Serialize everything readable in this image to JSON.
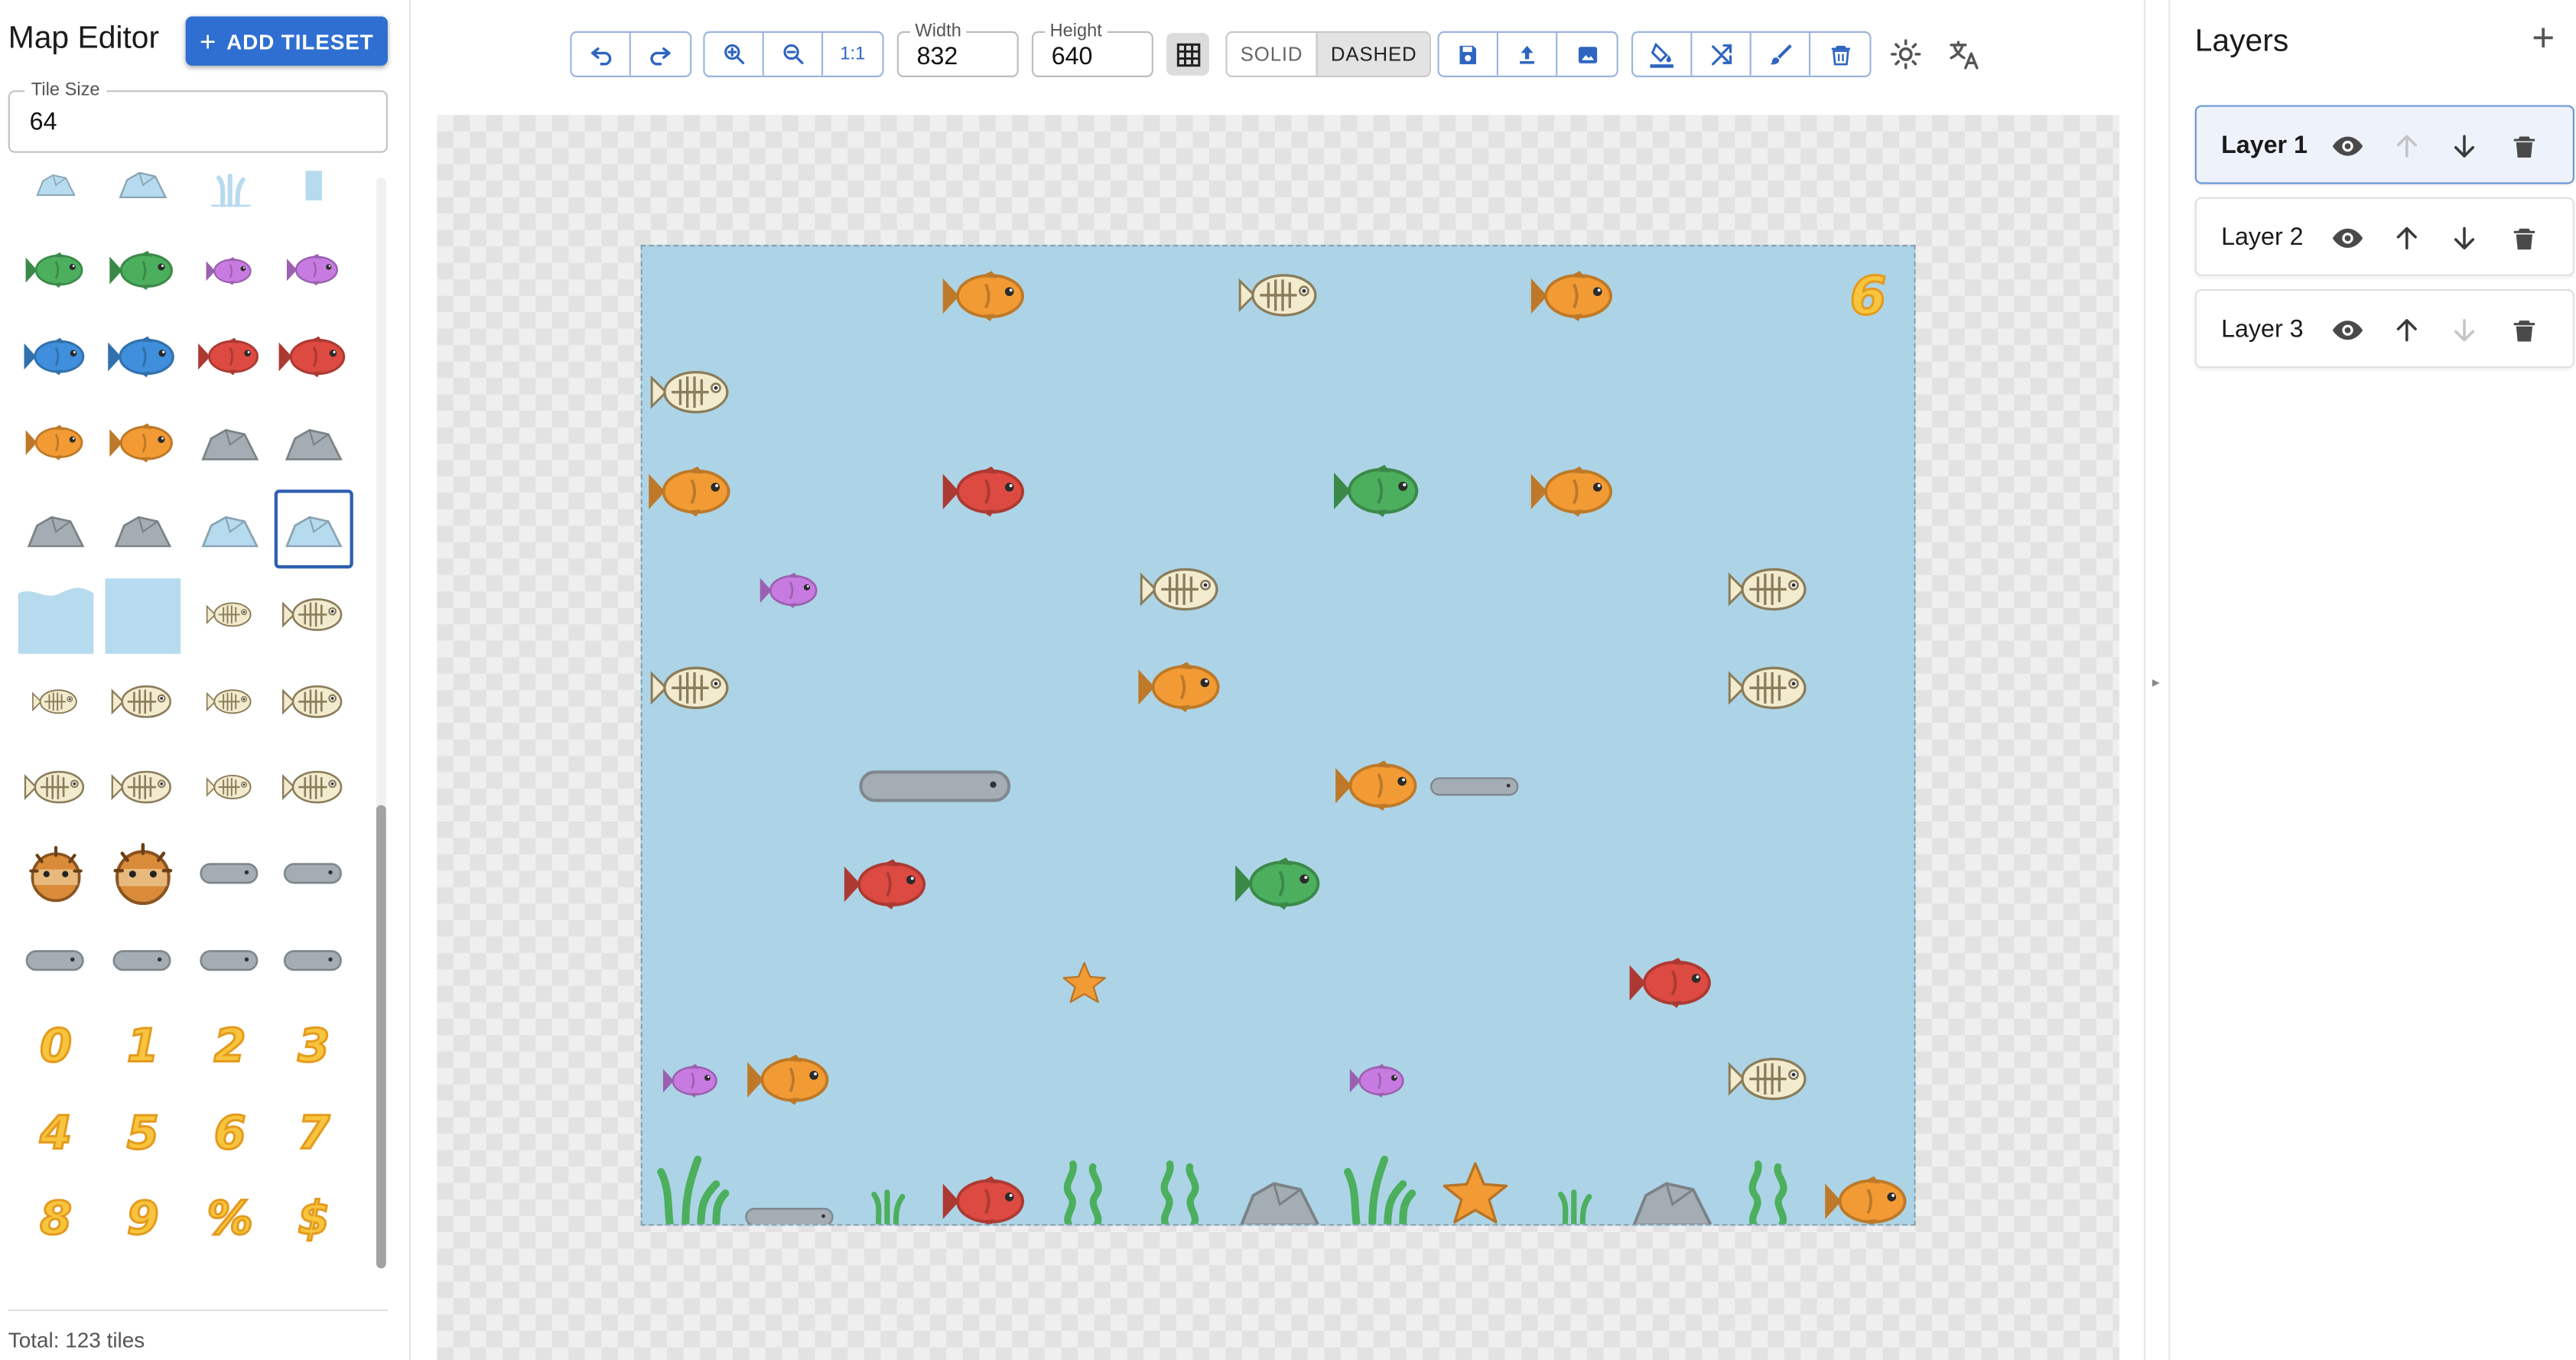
{
  "app": {
    "title": "Map Editor",
    "add_tileset_label": "ADD TILESET"
  },
  "tile_size": {
    "label": "Tile Size",
    "value": "64"
  },
  "palette": {
    "selected_index": 19,
    "tiles": [
      "tide-pool",
      "coral-plate",
      "seaweed-stubs",
      "ice-pillar",
      "green-fish-small",
      "green-fish",
      "purple-fish-small",
      "purple-fish",
      "blue-fish-small",
      "blue-fish",
      "red-fish-small",
      "red-fish",
      "orange-fish-small",
      "orange-fish",
      "grey-rock-small",
      "grey-rock",
      "grey-rock-flat",
      "grey-rock-tall",
      "blue-rock",
      "blue-rock-tall",
      "water-wave",
      "water-block",
      "fish-skeleton-small",
      "fish-skeleton",
      "fish-skeleton-tiny",
      "fish-skeleton-round",
      "fish-skeleton-thin",
      "fish-skeleton-alt",
      "fish-bones",
      "fish-bones-large",
      "fish-bones-small",
      "fish-skeleton-striped",
      "pufferfish-small",
      "pufferfish",
      "eel-head-small",
      "eel-head",
      "eel-body-left",
      "eel-body-tail",
      "eel-segment",
      "eel-tail",
      "digit-0",
      "digit-1",
      "digit-2",
      "digit-3",
      "digit-4",
      "digit-5",
      "digit-6",
      "digit-7",
      "digit-8",
      "digit-9",
      "percent-sign",
      "dollar-sign",
      "period-sign",
      "plus-sign"
    ],
    "glyphs": {
      "digit-0": "0",
      "digit-1": "1",
      "digit-2": "2",
      "digit-3": "3",
      "digit-4": "4",
      "digit-5": "5",
      "digit-6": "6",
      "digit-7": "7",
      "digit-8": "8",
      "digit-9": "9",
      "percent-sign": "%",
      "dollar-sign": "$",
      "period-sign": "•",
      "plus-sign": "+"
    },
    "total_label": "Total: 123 tiles"
  },
  "toolbar": {
    "history_buttons": [
      "undo-icon",
      "redo-icon"
    ],
    "zoom_buttons": [
      "zoom-in-icon",
      "zoom-out-icon"
    ],
    "zoom_reset_label": "1:1",
    "width": {
      "label": "Width",
      "value": "832"
    },
    "height": {
      "label": "Height",
      "value": "640"
    },
    "grid_toggle_icon": "grid-icon",
    "line_style": {
      "options": [
        "SOLID",
        "DASHED"
      ],
      "selected": "DASHED"
    },
    "file_buttons": [
      "save-icon",
      "upload-icon",
      "image-icon"
    ],
    "tool_buttons": [
      "fill-icon",
      "shuffle-icon",
      "brush-icon",
      "delete-icon"
    ],
    "theme_icon": "sun-icon",
    "language_icon": "translate-icon"
  },
  "layers": {
    "title": "Layers",
    "add_icon": "plus-icon",
    "items": [
      {
        "name": "Layer 1",
        "active": true,
        "can_move_up": false,
        "can_move_down": true
      },
      {
        "name": "Layer 2",
        "active": false,
        "can_move_up": true,
        "can_move_down": true
      },
      {
        "name": "Layer 3",
        "active": false,
        "can_move_up": true,
        "can_move_down": false
      }
    ]
  },
  "map": {
    "columns": 13,
    "rows": 10,
    "background_color": "#add4e6",
    "score_digit": "6",
    "placed_tiles": [
      {
        "tile": "orange-fish",
        "col": 3,
        "row": 0
      },
      {
        "tile": "fish-skeleton",
        "col": 6,
        "row": 0
      },
      {
        "tile": "orange-fish",
        "col": 9,
        "row": 0
      },
      {
        "tile": "digit-6",
        "col": 12,
        "row": 0
      },
      {
        "tile": "fish-skeleton",
        "col": 0,
        "row": 1
      },
      {
        "tile": "orange-fish",
        "col": 0,
        "row": 2
      },
      {
        "tile": "red-fish",
        "col": 3,
        "row": 2
      },
      {
        "tile": "green-fish",
        "col": 7,
        "row": 2
      },
      {
        "tile": "orange-fish",
        "col": 9,
        "row": 2
      },
      {
        "tile": "purple-fish",
        "col": 1,
        "row": 3
      },
      {
        "tile": "fish-skeleton",
        "col": 5,
        "row": 3
      },
      {
        "tile": "fish-skeleton",
        "col": 11,
        "row": 3
      },
      {
        "tile": "fish-skeleton",
        "col": 0,
        "row": 4
      },
      {
        "tile": "orange-fish",
        "col": 5,
        "row": 4
      },
      {
        "tile": "fish-skeleton",
        "col": 11,
        "row": 4
      },
      {
        "tile": "eel",
        "col": 2,
        "row": 5
      },
      {
        "tile": "orange-fish",
        "col": 7,
        "row": 5
      },
      {
        "tile": "eel-short",
        "col": 8,
        "row": 5
      },
      {
        "tile": "red-fish",
        "col": 2,
        "row": 6
      },
      {
        "tile": "green-fish",
        "col": 6,
        "row": 6
      },
      {
        "tile": "red-fish",
        "col": 10,
        "row": 7
      },
      {
        "tile": "small-starfish",
        "col": 4,
        "row": 7
      },
      {
        "tile": "purple-fish-small",
        "col": 0,
        "row": 8
      },
      {
        "tile": "orange-fish",
        "col": 1,
        "row": 8
      },
      {
        "tile": "purple-fish-small",
        "col": 7,
        "row": 8
      },
      {
        "tile": "fish-skeleton",
        "col": 11,
        "row": 8
      },
      {
        "tile": "seaweed",
        "col": 0,
        "row": 9
      },
      {
        "tile": "eel-head-small",
        "col": 1,
        "row": 9
      },
      {
        "tile": "seaweed-thin",
        "col": 2,
        "row": 9
      },
      {
        "tile": "red-fish",
        "col": 3,
        "row": 9
      },
      {
        "tile": "seaweed-curly",
        "col": 4,
        "row": 9
      },
      {
        "tile": "seaweed-curly",
        "col": 5,
        "row": 9
      },
      {
        "tile": "grey-rock",
        "col": 6,
        "row": 9
      },
      {
        "tile": "seaweed",
        "col": 7,
        "row": 9
      },
      {
        "tile": "orange-starfish",
        "col": 8,
        "row": 9
      },
      {
        "tile": "seaweed-thin",
        "col": 9,
        "row": 9
      },
      {
        "tile": "grey-rock",
        "col": 10,
        "row": 9
      },
      {
        "tile": "seaweed-curly",
        "col": 11,
        "row": 9
      },
      {
        "tile": "orange-fish",
        "col": 12,
        "row": 9
      }
    ]
  },
  "colors": {
    "accent": "#2f6fd1",
    "orange": "#f29b34",
    "red": "#dd4a41",
    "green": "#4caf5e",
    "purple": "#c77be0",
    "blue": "#3f8fdc",
    "bone": "#f3ebcd",
    "stone": "#a4adb3",
    "ice": "#b7dbee",
    "gold": "#f7c53d"
  }
}
